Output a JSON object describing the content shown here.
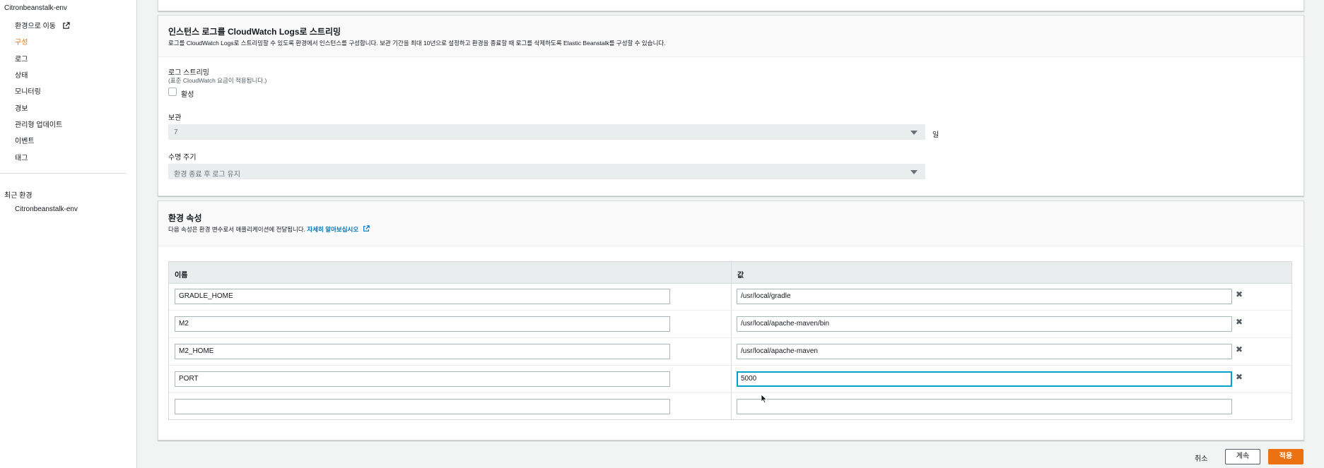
{
  "sidebar": {
    "env_name": "Citronbeanstalk-env",
    "items": [
      {
        "label": "환경으로 이동"
      },
      {
        "label": "구성"
      },
      {
        "label": "로그"
      },
      {
        "label": "상태"
      },
      {
        "label": "모니터링"
      },
      {
        "label": "경보"
      },
      {
        "label": "관리형 업데이트"
      },
      {
        "label": "이벤트"
      },
      {
        "label": "태그"
      }
    ],
    "recent_title": "최근 환경",
    "recent_items": [
      {
        "label": "Citronbeanstalk-env"
      }
    ]
  },
  "cloudwatch": {
    "title": "인스턴스 로그를 CloudWatch Logs로 스트리밍",
    "description": "로그를 CloudWatch Logs로 스트리밍할 수 있도록 환경에서 인스턴스를 구성합니다. 보관 기간을 최대 10년으로 설정하고 환경을 종료할 때 로그를 삭제하도록 Elastic Beanstalk를 구성할 수 있습니다.",
    "streaming_label": "로그 스트리밍",
    "streaming_note": "(표준 CloudWatch 요금이 적용됩니다.)",
    "enable_label": "활성",
    "retention_label": "보관",
    "retention_value": "7",
    "retention_unit": "일",
    "lifecycle_label": "수명 주기",
    "lifecycle_value": "환경 종료 후 로그 유지"
  },
  "env_props": {
    "title": "환경 속성",
    "description": "다음 속성은 환경 변수로서 애플리케이션에 전달됩니다.",
    "learn_more": "자세히 알아보십시오",
    "col_name": "이름",
    "col_value": "값",
    "rows": [
      {
        "name": "GRADLE_HOME",
        "value": "/usr/local/gradle"
      },
      {
        "name": "M2",
        "value": "/usr/local/apache-maven/bin"
      },
      {
        "name": "M2_HOME",
        "value": "/usr/local/apache-maven"
      },
      {
        "name": "PORT",
        "value": "5000"
      },
      {
        "name": "",
        "value": ""
      }
    ]
  },
  "footer": {
    "cancel": "취소",
    "next": "계속",
    "apply": "적용"
  },
  "colors": {
    "accent": "#ec7211",
    "link": "#0073bb"
  }
}
